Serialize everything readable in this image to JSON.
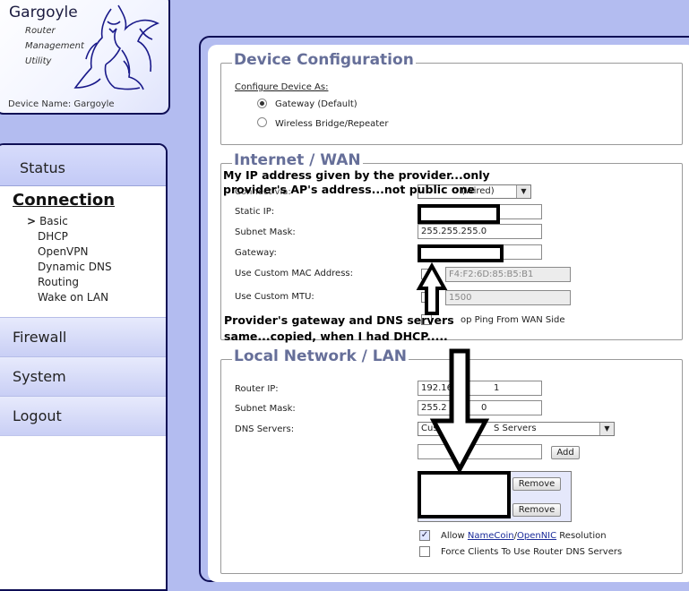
{
  "logo": {
    "title": "Gargoyle",
    "sub1": "Router",
    "sub2": "Management",
    "sub3": "Utility",
    "device_name_label": "Device Name: Gargoyle",
    "icon": "gargoyle-logo"
  },
  "nav": {
    "status": "Status",
    "connection": "Connection",
    "connection_items": [
      "Basic",
      "DHCP",
      "OpenVPN",
      "Dynamic DNS",
      "Routing",
      "Wake on LAN"
    ],
    "active_item": "Basic",
    "firewall": "Firewall",
    "system": "System",
    "logout": "Logout"
  },
  "device_config": {
    "title": "Device Configuration",
    "configure_as": "Configure Device As:",
    "opt_gateway": "Gateway (Default)",
    "opt_bridge": "Wireless Bridge/Repeater",
    "selected": "Gateway (Default)"
  },
  "wan": {
    "title": "Internet / WAN",
    "connect_select": "(Wired)",
    "static_ip_label": "Static IP:",
    "static_ip_value": "",
    "subnet_label": "Subnet Mask:",
    "subnet_value": "255.255.255.0",
    "gateway_label": "Gateway:",
    "gateway_value": "",
    "custom_mac_label": "Use Custom MAC Address:",
    "custom_mac_value": "F4:F2:6D:85:B5:B1",
    "custom_mtu_label": "Use Custom MTU:",
    "custom_mtu_value": "1500",
    "ping_label": "op Ping From WAN Side"
  },
  "lan": {
    "title": "Local Network / LAN",
    "router_ip_label": "Router IP:",
    "router_ip_value": "192.16",
    "router_ip_tail": "1",
    "subnet_label": "Subnet Mask:",
    "subnet_value": "255.2",
    "subnet_tail": "0",
    "dns_label": "DNS Servers:",
    "dns_select": "Cust",
    "dns_select_tail": "S Servers",
    "add_button": "Add",
    "remove_button": "Remove",
    "allow_prefix": "Allow",
    "namecoin": "NameCoin",
    "slash": "/",
    "opennic": "OpenNIC",
    "allow_suffix": "Resolution",
    "allow_checked": true,
    "force_label": "Force Clients To Use Router DNS Servers",
    "force_checked": false
  },
  "annotations": {
    "top_line1": "My IP address given by the provider...only",
    "top_line2": "provider's AP's address...not public one",
    "top_behind": "Connect via:",
    "bottom_line1": "Provider's gateway and DNS servers",
    "bottom_line2": "same...copied, when I had DHCP....."
  }
}
